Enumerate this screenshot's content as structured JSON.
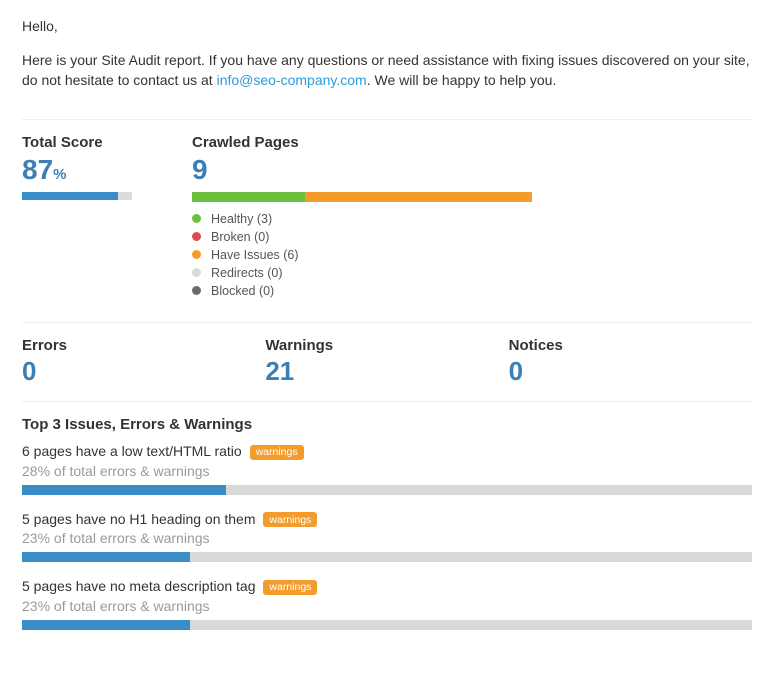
{
  "greeting": "Hello,",
  "intro_before": "Here is your Site Audit report. If you have any questions or need assistance with fixing issues discovered on your site, do not hesitate to contact us at ",
  "intro_link": "info@seo-company.com",
  "intro_after": ". We will be happy to help you.",
  "total_score": {
    "label": "Total Score",
    "value": "87",
    "unit": "%",
    "bar_pct": 87
  },
  "crawled": {
    "label": "Crawled Pages",
    "value": "9",
    "legend": {
      "healthy": "Healthy (3)",
      "broken": "Broken (0)",
      "issues": "Have Issues (6)",
      "redirects": "Redirects (0)",
      "blocked": "Blocked (0)"
    }
  },
  "chart_data": {
    "type": "bar",
    "title": "Crawled Pages",
    "series": [
      {
        "name": "Healthy",
        "value": 3,
        "color": "#6cbf3f"
      },
      {
        "name": "Broken",
        "value": 0,
        "color": "#d94c4c"
      },
      {
        "name": "Have Issues",
        "value": 6,
        "color": "#f39c2c"
      },
      {
        "name": "Redirects",
        "value": 0,
        "color": "#d9d9d9"
      },
      {
        "name": "Blocked",
        "value": 0,
        "color": "#6b6b6b"
      }
    ],
    "total": 9
  },
  "stats": {
    "errors": {
      "label": "Errors",
      "value": "0"
    },
    "warnings": {
      "label": "Warnings",
      "value": "21"
    },
    "notices": {
      "label": "Notices",
      "value": "0"
    }
  },
  "top_issues_title": "Top 3 Issues, Errors & Warnings",
  "issues": [
    {
      "text": "6 pages have a low text/HTML ratio",
      "tag": "warnings",
      "sub": "28% of total errors & warnings",
      "pct": 28
    },
    {
      "text": "5 pages have no H1 heading on them",
      "tag": "warnings",
      "sub": "23% of total errors & warnings",
      "pct": 23
    },
    {
      "text": "5 pages have no meta description tag",
      "tag": "warnings",
      "sub": "23% of total errors & warnings",
      "pct": 23
    }
  ]
}
